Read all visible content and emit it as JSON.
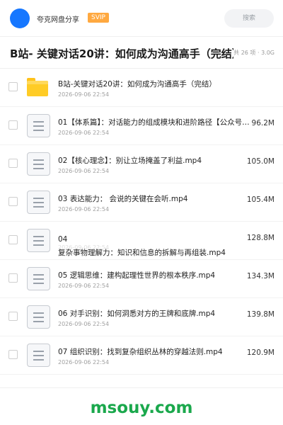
{
  "header": {
    "share_title": "夸克网盘分享",
    "badge": "SVIP",
    "search_label": "搜索",
    "accent_color": "#1677ff",
    "badge_color": "#ffa940"
  },
  "folder": {
    "title": "B站- 关键对话20讲：如何成为沟通高手（完结）",
    "meta": "共 26 项 · 3.0G"
  },
  "items": [
    {
      "icon": "folder-icon",
      "name": "B站-关键对话20讲：如何成为沟通高手（完结）",
      "date": "2026-09-06 22:54",
      "size": ""
    },
    {
      "icon": "file-icon",
      "name": "01【体系篇】：对话能力的组成模块和进阶路径【公众号：...",
      "date": "2026-09-06 22:54",
      "size": "96.2M"
    },
    {
      "icon": "file-icon",
      "name": "02【核心理念】：别让立场掩盖了利益.mp4",
      "date": "2026-09-06 22:54",
      "size": "105.0M"
    },
    {
      "icon": "file-icon",
      "name": "03 表达能力： 会说的关键在会听.mp4",
      "date": "2026-09-06 22:54",
      "size": "105.4M"
    },
    {
      "icon": "file-icon",
      "name_line1": "04",
      "name_line2": "复杂事物理解力：知识和信息的拆解与再组装.mp4",
      "date": "2026-09-06 22:54",
      "size": "128.8M"
    },
    {
      "icon": "file-icon",
      "name": "05 逻辑思维：建构起理性世界的根本秩序.mp4",
      "date": "2026-09-06 22:54",
      "size": "134.3M"
    },
    {
      "icon": "file-icon",
      "name": "06 对手识别：如何洞悉对方的王牌和底牌.mp4",
      "date": "2026-09-06 22:54",
      "size": "139.8M"
    },
    {
      "icon": "file-icon",
      "name": "07 组织识别：找到复杂组织丛林的穿越法则.mp4",
      "date": "2026-09-06 22:54",
      "size": "120.9M"
    }
  ],
  "watermark": "msouy.com"
}
